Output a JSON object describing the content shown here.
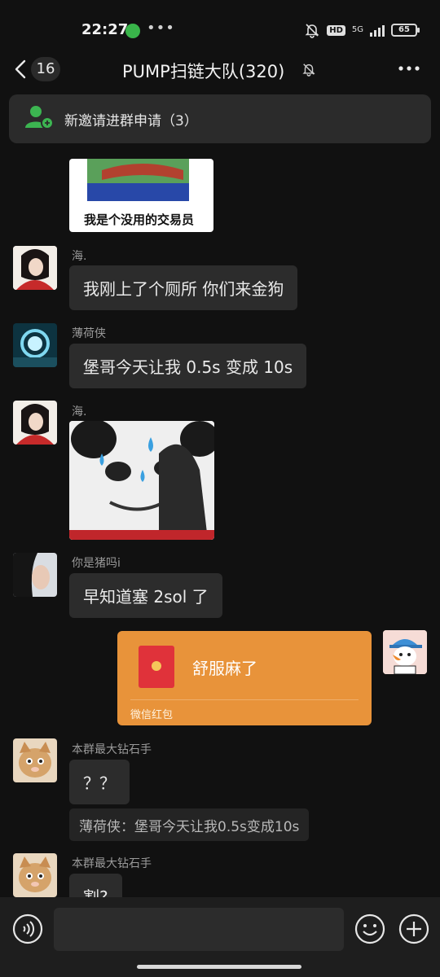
{
  "status_bar": {
    "time": "22:27",
    "dots": "•••",
    "hd": "HD",
    "network": "5G",
    "battery": "65"
  },
  "nav": {
    "unread_count": "16",
    "title": "PUMP扫链大队(320)"
  },
  "banner": {
    "text": "新邀请进群申请（3）"
  },
  "messages": [
    {
      "sender": "",
      "type": "sticker",
      "caption": "我是个没用的交易员"
    },
    {
      "sender": "海.",
      "type": "text",
      "text": "我刚上了个厕所 你们来金狗"
    },
    {
      "sender": "薄荷侠",
      "type": "text",
      "text": "堡哥今天让我 0.5s 变成 10s"
    },
    {
      "sender": "海.",
      "type": "sticker"
    },
    {
      "sender": "你是猪吗i",
      "type": "text",
      "text": "早知道塞 2sol 了"
    },
    {
      "sender": "me",
      "type": "red_packet",
      "title": "舒服麻了",
      "label": "微信红包"
    },
    {
      "sender": "本群最大钻石手",
      "type": "text",
      "text": "？？",
      "quote": "薄荷侠：堡哥今天让我0.5s变成10s"
    },
    {
      "sender": "本群最大钻石手",
      "type": "text",
      "text": "割?"
    }
  ],
  "colors": {
    "background": "#111111",
    "bubble": "#2c2c2c",
    "red_packet": "#e8933a",
    "banner": "#2b2b2b",
    "invite_icon": "#3cb551"
  }
}
